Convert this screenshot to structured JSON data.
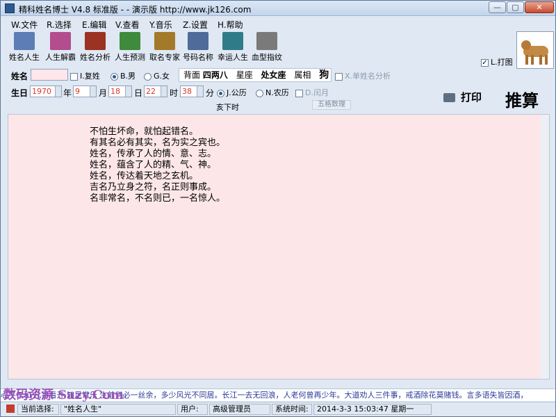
{
  "window": {
    "title": "精科姓名博士  V4.8  标准版 -  - 演示版  http://www.jk126.com"
  },
  "menu": [
    "W.文件",
    "R.选择",
    "E.编辑",
    "V.查看",
    "Y.音乐",
    "Z.设置",
    "H.帮助"
  ],
  "toolbar": [
    {
      "label": "姓名人生",
      "icon": "books-icon",
      "color": "#5c7db5"
    },
    {
      "label": "人生解霸",
      "icon": "books-icon",
      "color": "#b34d8e"
    },
    {
      "label": "姓名分析",
      "icon": "open-book-icon",
      "color": "#9b3222"
    },
    {
      "label": "人生预测",
      "icon": "books-icon",
      "color": "#3f8a3d"
    },
    {
      "label": "取名专家",
      "icon": "books-icon",
      "color": "#a37a29"
    },
    {
      "label": "号码名称",
      "icon": "open-book-icon",
      "color": "#4e6b9a"
    },
    {
      "label": "幸运人生",
      "icon": "books-icon",
      "color": "#2f7c88"
    },
    {
      "label": "血型指纹",
      "icon": "book-icon",
      "color": "#7a7a7a"
    }
  ],
  "print_check": {
    "label": "L.打图",
    "checked": true
  },
  "name_row": {
    "label": "姓名",
    "value": "",
    "compound_surname": "I.复姓",
    "male": "B.男",
    "female": "G.女",
    "male_selected": true,
    "zodiac_prefix": "背面",
    "info_parts": [
      "四两八",
      "星座",
      "处女座",
      "属相",
      "狗"
    ],
    "single_name": "X.单姓名分析"
  },
  "birth_row": {
    "label": "生日",
    "year": "1970",
    "year_unit": "年",
    "month": "9",
    "month_unit": "月",
    "day": "18",
    "day_unit": "日",
    "hour": "22",
    "hour_unit": "时",
    "minute": "38",
    "minute_unit": "分",
    "solar": "J.公历",
    "lunar": "N.农历",
    "leap": "D.闰月",
    "solar_selected": true
  },
  "hour_label": "亥下时",
  "wuge_button": "五格数理",
  "print_button": "打印",
  "calc_button": "推算",
  "verses": [
    "不怕生坏命，就怕起错名。",
    "有其名必有其实，名为实之宾也。",
    "姓名，传承了人的情、意、志。",
    "姓名，蕴含了人的精、气、神。",
    "姓名，传达着天地之玄机。",
    "吉名乃立身之符，名正则事成。",
    "名非常名，不名则已，一名惊人。"
  ],
  "ticker": "心平气和    凡事看开    知足常乐    生前何必一丝余，多少风光不同居。长江一去无回浪，人老何曾再少年。大道劝人三件事，戒酒除花莫赌钱。言多语失皆因酒，",
  "watermark": "数码资源 Sazy.Com",
  "status": {
    "current_label": "当前选择:",
    "current_value": "\"姓名人生\"",
    "user_label": "用户:",
    "user_value": "高级管理员",
    "time_label": "系统时间:",
    "time_value": "2014-3-3  15:03:47  星期一"
  }
}
